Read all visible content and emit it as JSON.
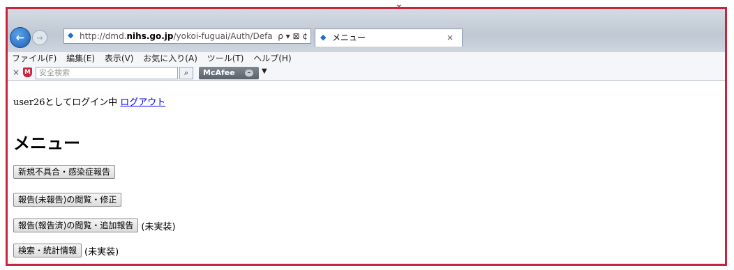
{
  "browser": {
    "address_url": "http://dmd.nihs.go.jp/yokoi-fuguai/Auth/Defa",
    "address_domain_prefix": "http://dmd.",
    "address_domain_bold": "nihs.go.jp",
    "address_path": "/yokoi-fuguai/Auth/Defa",
    "address_tools": "ρ ▾ ⊠ ¢",
    "tab_title": "メニュー",
    "tab_close": "×"
  },
  "menubar": {
    "items": [
      "ファイル(F)",
      "編集(E)",
      "表示(V)",
      "お気に入り(A)",
      "ツール(T)",
      "ヘルプ(H)"
    ]
  },
  "toolbar": {
    "close": "×",
    "search_placeholder": "安全検索",
    "mcafee_label": "McAfee"
  },
  "page": {
    "user_text": "user26としてログイン中",
    "logout_link": "ログアウト",
    "title": "メニュー",
    "buttons": [
      {
        "label": "新規不具合・感染症報告",
        "note": ""
      },
      {
        "label": "報告(未報告)の閲覧・修正",
        "note": ""
      },
      {
        "label": "報告(報告済)の閲覧・追加報告",
        "note": "(未実装)"
      },
      {
        "label": "検索・統計情報",
        "note": "(未実装)"
      }
    ]
  }
}
